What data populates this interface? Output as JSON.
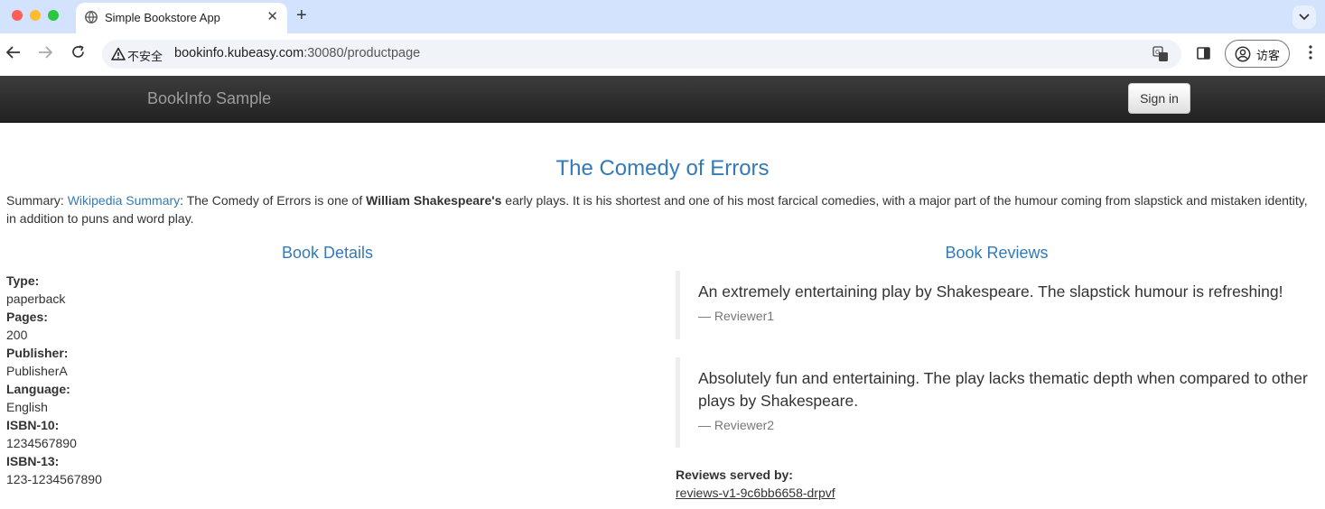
{
  "browser": {
    "tab_title": "Simple Bookstore App",
    "tab_close": "✕",
    "new_tab": "+",
    "security_label": "不安全",
    "url_host": "bookinfo.kubeasy.com",
    "url_path": ":30080/productpage",
    "profile_label": "访客",
    "icons": [
      "globe-icon",
      "back-icon",
      "forward-icon",
      "reload-icon",
      "warning-icon",
      "translate-icon",
      "side-panel-icon",
      "profile-icon",
      "menu-icon"
    ]
  },
  "navbar": {
    "brand": "BookInfo Sample",
    "signin_label": "Sign in"
  },
  "product": {
    "title": "The Comedy of Errors",
    "summary_prefix": "Summary: ",
    "summary_link": "Wikipedia Summary",
    "summary_part1": ": The Comedy of Errors is one of ",
    "summary_bold": "William Shakespeare's",
    "summary_part2": " early plays. It is his shortest and one of his most farcical comedies, with a major part of the humour coming from slapstick and mistaken identity, in addition to puns and word play."
  },
  "details": {
    "heading": "Book Details",
    "items": [
      {
        "label": "Type:",
        "value": "paperback"
      },
      {
        "label": "Pages:",
        "value": "200"
      },
      {
        "label": "Publisher:",
        "value": "PublisherA"
      },
      {
        "label": "Language:",
        "value": "English"
      },
      {
        "label": "ISBN-10:",
        "value": "1234567890"
      },
      {
        "label": "ISBN-13:",
        "value": "123-1234567890"
      }
    ]
  },
  "reviews": {
    "heading": "Book Reviews",
    "items": [
      {
        "text": "An extremely entertaining play by Shakespeare. The slapstick humour is refreshing!",
        "reviewer": "— Reviewer1"
      },
      {
        "text": "Absolutely fun and entertaining. The play lacks thematic depth when compared to other plays by Shakespeare.",
        "reviewer": "— Reviewer2"
      }
    ],
    "served_by_label": "Reviews served by:",
    "served_by_value": "reviews-v1-9c6bb6658-drpvf"
  }
}
